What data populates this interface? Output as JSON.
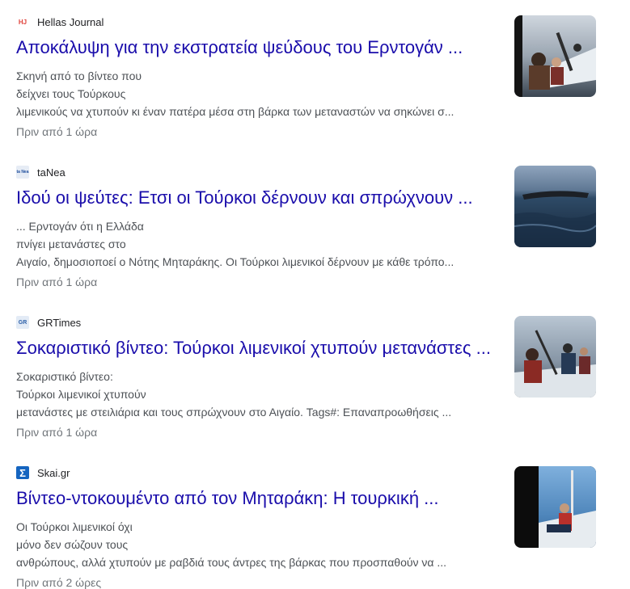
{
  "articles": [
    {
      "source": "Hellas Journal",
      "favicon_icon": "hellas-journal-logo-icon",
      "favicon_text": "HJ",
      "favicon_color": "#e0413a",
      "headline": "Αποκάλυψη για την εκστρατεία ψεύδους του Ερντογάν ...",
      "snippet_lines": [
        "Σκηνή από το βίντεο που",
        "δείχνει τους Τούρκους",
        "λιμενικούς να χτυπούν κι έναν πατέρα μέσα στη βάρκα των μεταναστών να σηκώνει σ..."
      ],
      "time": "Πριν από 1 ώρα"
    },
    {
      "source": "taNea",
      "favicon_icon": "tanea-logo-icon",
      "favicon_text": "ta Nea",
      "favicon_color": "#1f4e9c",
      "headline": "Ιδού οι ψεύτες: Ετσι οι Τούρκοι δέρνουν και σπρώχνουν ...",
      "snippet_lines": [
        "... Ερντογάν ότι η Ελλάδα",
        "πνίγει μετανάστες στο",
        "Αιγαίο, δημοσιοποεί ο Νότης Μηταράκης. Οι Τούρκοι λιμενικοί δέρνουν με κάθε τρόπο..."
      ],
      "time": "Πριν από 1 ώρα"
    },
    {
      "source": "GRTimes",
      "favicon_icon": "grtimes-logo-icon",
      "favicon_text": "GR",
      "favicon_color": "#2b5fa8",
      "headline": "Σοκαριστικό βίντεο: Τούρκοι λιμενικοί χτυπούν μετανάστες ...",
      "snippet_lines": [
        "Σοκαριστικό βίντεο:",
        "Τούρκοι λιμενικοί χτυπούν",
        "μετανάστες με στειλιάρια και τους σπρώχνουν στο Αιγαίο. Tags#: Επαναπροωθήσεις ..."
      ],
      "time": "Πριν από 1 ώρα"
    },
    {
      "source": "Skai.gr",
      "favicon_icon": "skai-sigma-logo-icon",
      "favicon_text": "Σ",
      "favicon_color": "#1565c0",
      "headline": "Βίντεο-ντοκουμέντο από τον Μηταράκη: Η τουρκική ...",
      "snippet_lines": [
        "Οι Τούρκοι λιμενικοί όχι",
        "μόνο δεν σώζουν τους",
        "ανθρώπους, αλλά χτυπούν με ραβδιά τους άντρες της βάρκας που προσπαθούν να ..."
      ],
      "time": "Πριν από 2 ώρες"
    }
  ]
}
